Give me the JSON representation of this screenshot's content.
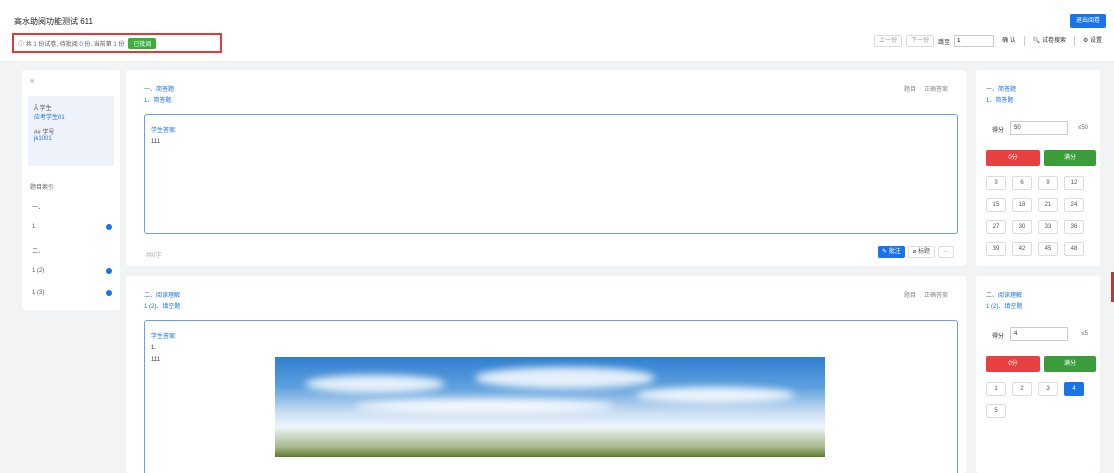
{
  "header": {
    "title": "高水助阅功能测试 611",
    "exit_label": "退出阅卷",
    "summary": {
      "prefix": "ⓘ 共",
      "total": "1",
      "mid1": "份试卷, 待批阅",
      "pending": "0",
      "mid2": "份, 当前第",
      "current": "1",
      "suffix": "份",
      "status": "已批阅"
    },
    "toolbar": {
      "prev": "上一份",
      "next": "下一份",
      "jump_label": "跳至",
      "jump_value": "1",
      "confirm": "确 认",
      "search": "🔍 试卷搜索",
      "settings": "⚙ 设置"
    }
  },
  "sidebar": {
    "collapse": "«",
    "student_label": "Ã 学生",
    "student_value": "应考学生01",
    "id_label": "## 学号",
    "id_value": "jk1001",
    "index_title": "题目索引",
    "items": [
      {
        "label": "一、",
        "dot": false
      },
      {
        "label": "1",
        "dot": true
      },
      {
        "label": "二、",
        "dot": false
      },
      {
        "label": "1 (2)",
        "dot": true
      },
      {
        "label": "1 (3)",
        "dot": true
      }
    ]
  },
  "cards": [
    {
      "title": "一、简答题",
      "subtitle": "1、简答题",
      "actions": [
        "题目",
        "正确答案"
      ],
      "answer_label": "学生答案:",
      "answer_lines": [
        "111"
      ],
      "footer": "共0字",
      "annotate": "✎ 批注",
      "mark": "⌀ 标题",
      "more": "···"
    },
    {
      "title": "二、阅读理解",
      "subtitle": "1 (2)、填空题",
      "actions": [
        "题目",
        "正确答案"
      ],
      "answer_label": "学生答案:",
      "answer_lines": [
        "1.",
        "111"
      ]
    }
  ],
  "score_panels": [
    {
      "title": "一、简答题",
      "subtitle": "1、简答题",
      "score_label": "得分",
      "score_value": "50",
      "max": "≤50",
      "zero": "0分",
      "full": "满分",
      "numbers": [
        "3",
        "6",
        "9",
        "12",
        "15",
        "18",
        "21",
        "24",
        "27",
        "30",
        "33",
        "36",
        "39",
        "42",
        "45",
        "48"
      ],
      "active": ""
    },
    {
      "title": "二、阅读理解",
      "subtitle": "1 (2)、填空题",
      "score_label": "得分",
      "score_value": "4",
      "max": "≤5",
      "zero": "0分",
      "full": "满分",
      "numbers": [
        "1",
        "2",
        "3",
        "4",
        "5"
      ],
      "active": "4"
    }
  ],
  "colors": {
    "accent": "#1a73e8",
    "danger": "#e84040",
    "success": "#3a9d3a",
    "highlight_box": "#e53935"
  }
}
